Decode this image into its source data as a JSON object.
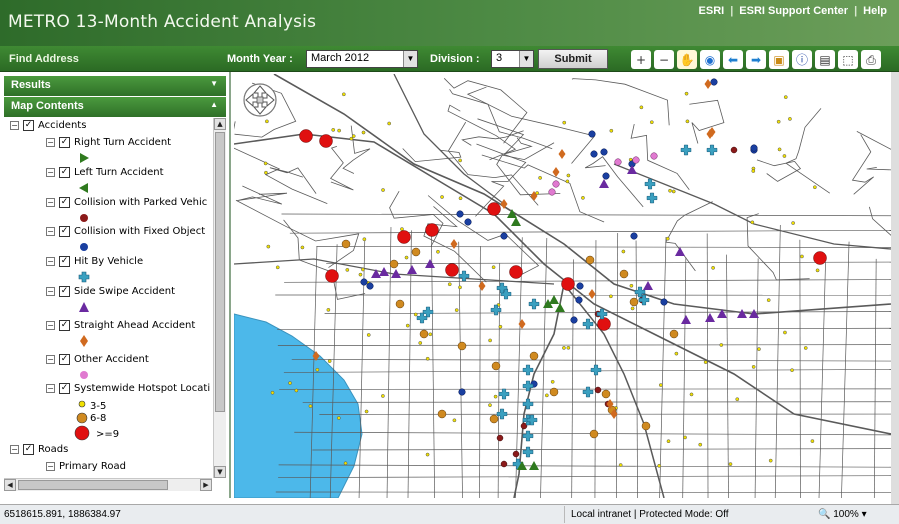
{
  "app": {
    "title": "METRO 13-Month Accident Analysis",
    "links": [
      "ESRI",
      "ESRI Support Center",
      "Help"
    ]
  },
  "toolbar": {
    "find_address": "Find Address",
    "month_year_label": "Month Year :",
    "month_year_value": "March 2012",
    "division_label": "Division :",
    "division_value": "3",
    "submit_label": "Submit",
    "tools": [
      {
        "name": "zoom-in-icon",
        "glyph": "+",
        "color": "#333333"
      },
      {
        "name": "zoom-out-icon",
        "glyph": "−",
        "color": "#333333"
      },
      {
        "name": "pan-hand-icon",
        "glyph": "✋",
        "color": "#a0680e"
      },
      {
        "name": "full-extent-globe-icon",
        "glyph": "◉",
        "color": "#1f6fd0"
      },
      {
        "name": "back-arrow-icon",
        "glyph": "⬅",
        "color": "#1f7fd0"
      },
      {
        "name": "forward-arrow-icon",
        "glyph": "➡",
        "color": "#1f7fd0"
      },
      {
        "name": "select-features-icon",
        "glyph": "▣",
        "color": "#c98a15"
      },
      {
        "name": "identify-icon",
        "glyph": "ⓘ",
        "color": "#1a3fa0"
      },
      {
        "name": "measure-icon",
        "glyph": "▤",
        "color": "#333333"
      },
      {
        "name": "select-tool-icon",
        "glyph": "⬚",
        "color": "#333333"
      },
      {
        "name": "print-icon",
        "glyph": "⎙",
        "color": "#333333"
      }
    ]
  },
  "panel": {
    "results_label": "Results",
    "contents_label": "Map Contents"
  },
  "toc": {
    "accidents_label": "Accidents",
    "accident_layers": [
      {
        "label": "Right Turn Accident",
        "symbol": "right-triangle",
        "color": "#2f7a1f"
      },
      {
        "label": "Left Turn Accident",
        "symbol": "left-triangle",
        "color": "#2f7a1f"
      },
      {
        "label": "Collision with Parked Vehic",
        "symbol": "dot",
        "color": "#8b1a1a"
      },
      {
        "label": "Collision with Fixed Object",
        "symbol": "dot",
        "color": "#1a3fa0"
      },
      {
        "label": "Hit By Vehicle",
        "symbol": "cross",
        "color": "#3aa0c0"
      },
      {
        "label": "Side Swipe Accident",
        "symbol": "up-triangle",
        "color": "#6a2aa0"
      },
      {
        "label": "Straight Ahead Accident",
        "symbol": "diamond",
        "color": "#d06a1f"
      },
      {
        "label": "Other Accident",
        "symbol": "dot",
        "color": "#e07ad0"
      }
    ],
    "hotspot_label": "Systemwide Hotspot Locati",
    "hotspot_classes": [
      {
        "label": "3-5",
        "color": "#f0e000"
      },
      {
        "label": "6-8",
        "color": "#d08a20"
      },
      {
        "label": ">=9",
        "color": "#e01010"
      }
    ],
    "roads_label": "Roads",
    "primary_road_label": "Primary Road"
  },
  "status": {
    "coords": "6518615.891, 1886384.97",
    "zone": "Local intranet | Protected Mode: Off",
    "zoom": "100%"
  },
  "colors": {
    "header_green": "#2e6b2a",
    "water": "#4cb8ea",
    "road": "#5a5a5a"
  }
}
